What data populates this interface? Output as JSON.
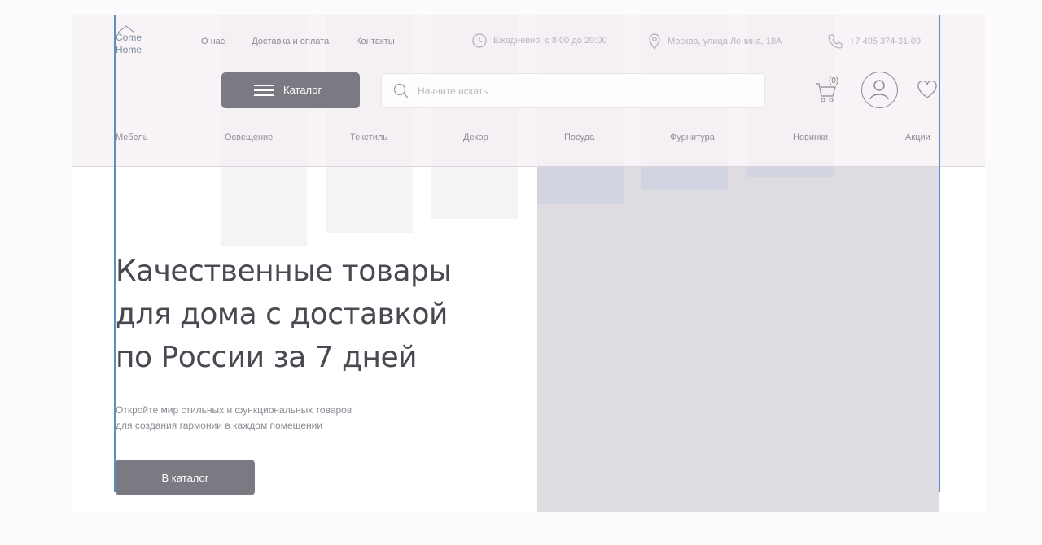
{
  "logo": {
    "line1": "Come",
    "line2": "Home"
  },
  "top_links": [
    "О нас",
    "Доставка и оплата",
    "Контакты"
  ],
  "info": {
    "hours": "Ежедневно, с 8:00 до 20:00",
    "address": "Москва, улица Ленина, 18А",
    "phone": "+7 495 374-31-09"
  },
  "catalog_button": "Каталог",
  "search": {
    "placeholder": "Начните искать",
    "value": ""
  },
  "cart": {
    "count": "(0)"
  },
  "categories": [
    "Мебель",
    "Освещение",
    "Текстиль",
    "Декор",
    "Посуда",
    "Фурнитура",
    "Новинки",
    "Акции"
  ],
  "hero": {
    "title": [
      "Качественные товары",
      "для дома с доставкой",
      "по России за 7 дней"
    ],
    "subtitle": [
      "Откройте мир стильных и функциональных товаров",
      "для создания гармонии в каждом помещении"
    ],
    "cta": "В каталог"
  },
  "colors": {
    "button": "#7b7982",
    "guide": "#5b8fc3",
    "image_placeholder": "#dedbe1"
  }
}
